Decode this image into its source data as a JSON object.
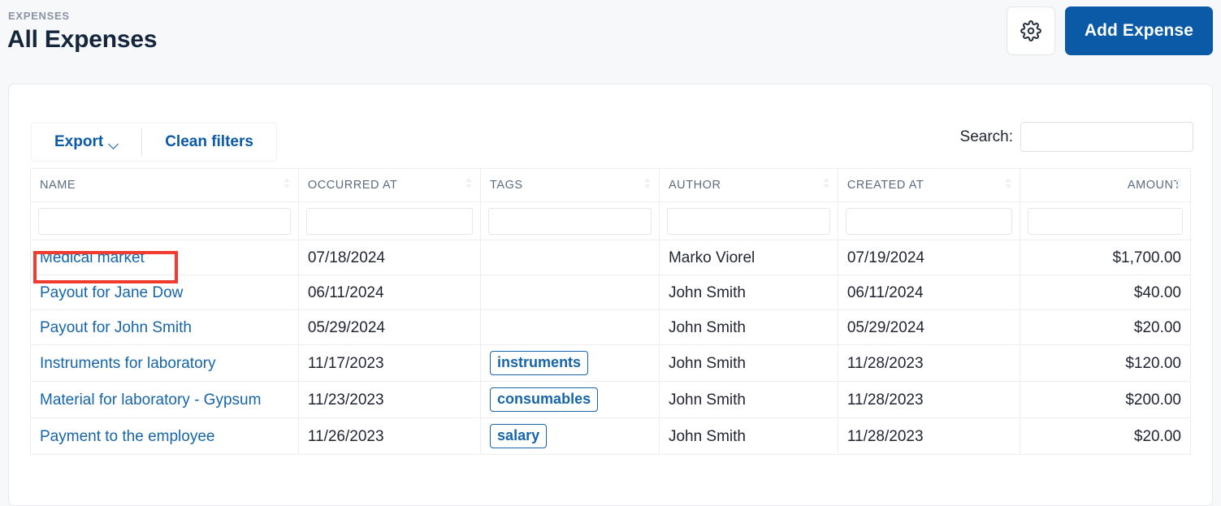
{
  "header": {
    "eyebrow": "EXPENSES",
    "title": "All Expenses",
    "settings_icon": "gear-icon",
    "add_button": "Add Expense"
  },
  "toolbar": {
    "export_label": "Export",
    "export_caret": "chevron-down-icon",
    "clean_filters_label": "Clean filters",
    "search_label": "Search:",
    "search_value": "",
    "search_placeholder": ""
  },
  "table": {
    "columns": [
      {
        "label": "NAME",
        "align": "left",
        "sortable": true
      },
      {
        "label": "OCCURRED AT",
        "align": "left",
        "sortable": true
      },
      {
        "label": "TAGS",
        "align": "left",
        "sortable": true
      },
      {
        "label": "AUTHOR",
        "align": "left",
        "sortable": true
      },
      {
        "label": "CREATED AT",
        "align": "left",
        "sortable": true
      },
      {
        "label": "AMOUNT",
        "align": "right",
        "sortable": true
      }
    ],
    "filters": [
      "",
      "",
      "",
      "",
      "",
      ""
    ],
    "rows": [
      {
        "name": "Medical market",
        "occurred_at": "07/18/2024",
        "tag": "",
        "author": "Marko Viorel",
        "created_at": "07/19/2024",
        "amount": "$1,700.00",
        "highlighted": true
      },
      {
        "name": "Payout for Jane Dow",
        "occurred_at": "06/11/2024",
        "tag": "",
        "author": "John Smith",
        "created_at": "06/11/2024",
        "amount": "$40.00",
        "highlighted": false
      },
      {
        "name": "Payout for John Smith",
        "occurred_at": "05/29/2024",
        "tag": "",
        "author": "John Smith",
        "created_at": "05/29/2024",
        "amount": "$20.00",
        "highlighted": false
      },
      {
        "name": "Instruments for laboratory",
        "occurred_at": "11/17/2023",
        "tag": "instruments",
        "author": "John Smith",
        "created_at": "11/28/2023",
        "amount": "$120.00",
        "highlighted": false
      },
      {
        "name": "Material for laboratory - Gypsum",
        "occurred_at": "11/23/2023",
        "tag": "consumables",
        "author": "John Smith",
        "created_at": "11/28/2023",
        "amount": "$200.00",
        "highlighted": false
      },
      {
        "name": "Payment to the employee",
        "occurred_at": "11/26/2023",
        "tag": "salary",
        "author": "John Smith",
        "created_at": "11/28/2023",
        "amount": "$20.00",
        "highlighted": false
      }
    ]
  },
  "colors": {
    "accent": "#0a5aa8",
    "link": "#1565a8",
    "page_bg": "#f7f8fa",
    "title": "#15253c",
    "eyebrow": "#8a93a3",
    "highlight": "#ef3b30"
  }
}
